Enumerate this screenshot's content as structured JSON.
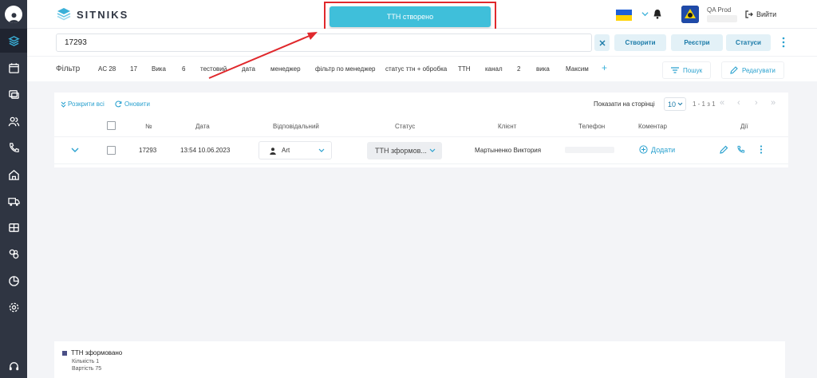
{
  "app": {
    "logo": "SITNIKS"
  },
  "toast": {
    "text": "ТТН створено"
  },
  "user": {
    "name": "QA Prod",
    "logout": "Вийти"
  },
  "search": {
    "value": "17293"
  },
  "toolbar": {
    "create": "Створити",
    "registers": "Реєстри",
    "statuses": "Статуси"
  },
  "filter": {
    "label": "Фільтр",
    "chips": [
      "AC 28",
      "17",
      "Вика",
      "6",
      "тестовий",
      "дата",
      "менеджер",
      "фільтр по менеджер",
      "статус ттн + обробка",
      "ТТН",
      "канал",
      "2",
      "вика",
      "Максим"
    ],
    "search": "Пошук",
    "edit": "Редагувати"
  },
  "table": {
    "expand_all": "Розкрити всі",
    "refresh": "Оновити",
    "per_page_label": "Показати на сторінці",
    "per_page": "10",
    "range": "1 - 1 з 1",
    "columns": [
      "№",
      "Дата",
      "Відповідальний",
      "Статус",
      "Клієнт",
      "Телефон",
      "Коментар",
      "Дії"
    ],
    "rows": [
      {
        "number": "17293",
        "date": "13:54 10.06.2023",
        "responsible": "Art",
        "status": "ТТН зформов...",
        "client": "Мартыненко Виктория",
        "comment_action": "Додати"
      }
    ]
  },
  "summary": {
    "title": "ТТН зформовано",
    "count": "Кількість 1",
    "value": "Вартість 75"
  },
  "colors": {
    "accent": "#2aa1cf",
    "toast": "#3fbfda",
    "sidebar": "#2f3542",
    "annotation": "#e0282c"
  }
}
